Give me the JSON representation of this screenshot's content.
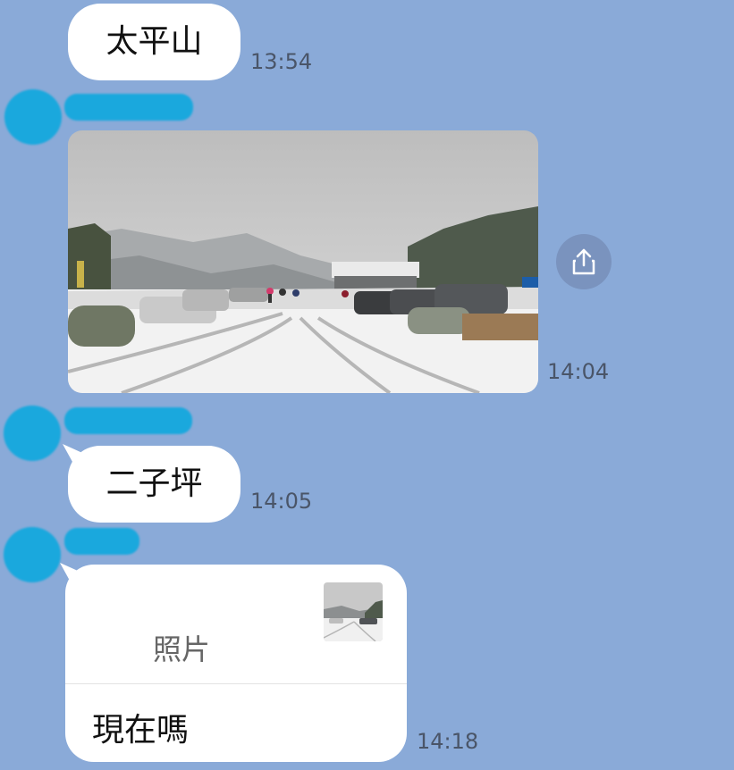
{
  "messages": [
    {
      "text": "太平山",
      "time": "13:54"
    },
    {
      "type": "photo",
      "time": "14:04"
    },
    {
      "text": "二子坪",
      "time": "14:05"
    },
    {
      "type": "reply",
      "quote_label": "照片",
      "text": "現在嗎",
      "time": "14:18"
    }
  ],
  "icons": {
    "share": "share-icon",
    "avatar": "avatar-redacted"
  },
  "colors": {
    "chat_background": "#8aaad8",
    "bubble": "#ffffff",
    "redaction": "#1aa8dd",
    "share_button": "#7a93be"
  }
}
